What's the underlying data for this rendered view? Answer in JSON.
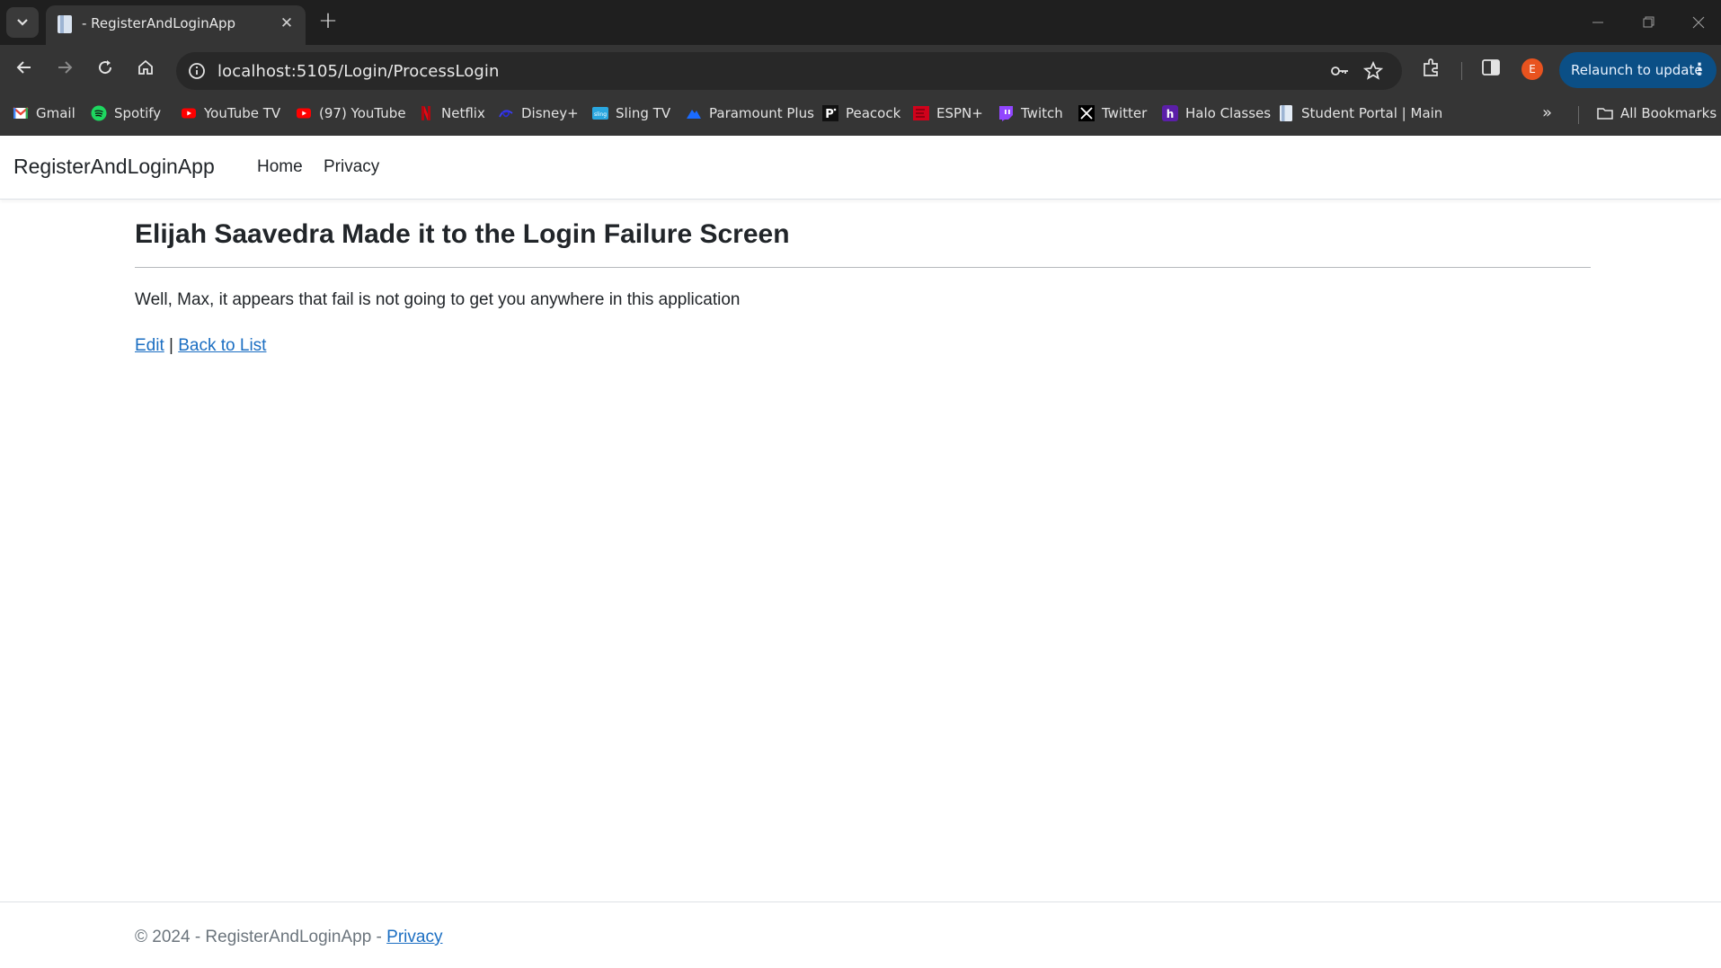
{
  "browser": {
    "tab_title": "- RegisterAndLoginApp",
    "url": "localhost:5105/Login/ProcessLogin",
    "avatar_letter": "E",
    "relaunch_label": "Relaunch to update",
    "bookmarks": [
      {
        "label": "Gmail",
        "icon": "gmail-icon"
      },
      {
        "label": "Spotify",
        "icon": "spotify-icon"
      },
      {
        "label": "YouTube TV",
        "icon": "youtube-tv-icon"
      },
      {
        "label": "(97) YouTube",
        "icon": "youtube-icon"
      },
      {
        "label": "Netflix",
        "icon": "netflix-icon"
      },
      {
        "label": "Disney+",
        "icon": "disney-icon"
      },
      {
        "label": "Sling TV",
        "icon": "sling-icon"
      },
      {
        "label": "Paramount Plus",
        "icon": "paramount-icon"
      },
      {
        "label": "Peacock",
        "icon": "peacock-icon"
      },
      {
        "label": "ESPN+",
        "icon": "espn-icon"
      },
      {
        "label": "Twitch",
        "icon": "twitch-icon"
      },
      {
        "label": "Twitter",
        "icon": "x-icon"
      },
      {
        "label": "Halo Classes",
        "icon": "halo-icon"
      },
      {
        "label": "Student Portal | Main",
        "icon": "document-icon"
      }
    ],
    "all_bookmarks_label": "All Bookmarks"
  },
  "site": {
    "brand": "RegisterAndLoginApp",
    "nav": {
      "home": "Home",
      "privacy": "Privacy"
    }
  },
  "content": {
    "heading": "Elijah Saavedra Made it to the Login Failure Screen",
    "message": "Well, Max, it appears that fail is not going to get you anywhere in this application",
    "edit_link": "Edit",
    "separator": "|",
    "back_link": "Back to List"
  },
  "footer": {
    "copyright": "© 2024 - RegisterAndLoginApp - ",
    "privacy_link": "Privacy"
  },
  "colors": {
    "link": "#1b6ec2",
    "relaunch_bg": "#0b4f86",
    "avatar_bg": "#e8531f"
  }
}
